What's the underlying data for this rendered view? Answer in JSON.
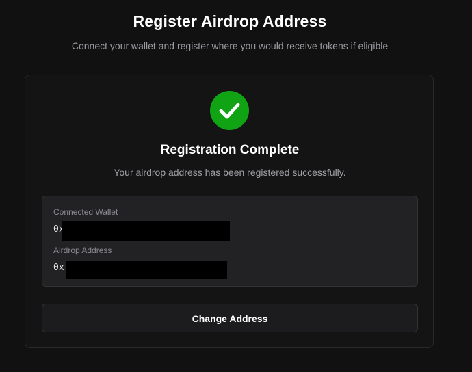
{
  "header": {
    "title": "Register Airdrop Address",
    "subtitle": "Connect your wallet and register where you would receive tokens if eligible"
  },
  "card": {
    "status_icon": "check-icon",
    "status_color": "#10a313",
    "title": "Registration Complete",
    "message": "Your airdrop address has been registered successfully.",
    "connected_wallet": {
      "label": "Connected Wallet",
      "value_prefix": "0x"
    },
    "airdrop_address": {
      "label": "Airdrop Address",
      "value_prefix": "0x"
    },
    "change_button_label": "Change Address"
  }
}
